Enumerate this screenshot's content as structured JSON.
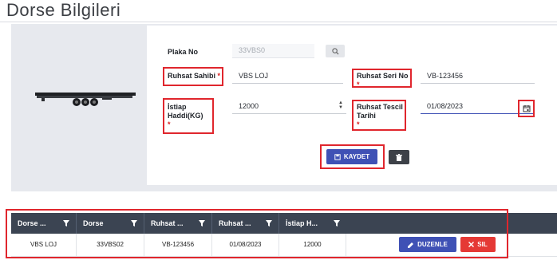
{
  "page": {
    "title": "Dorse Bilgileri"
  },
  "form": {
    "plaka": {
      "label": "Plaka No",
      "value": "33VBS0"
    },
    "ruhsat_sahibi": {
      "label": "Ruhsat Sahibi",
      "required_mark": "*",
      "value": "VBS LOJ"
    },
    "ruhsat_seri": {
      "label": "Ruhsat Seri No",
      "required_mark": "*",
      "value": "VB-123456"
    },
    "istiap": {
      "label_line1": "İstiap",
      "label_line2": "Haddi(KG)",
      "required_mark": "*",
      "value": "12000"
    },
    "tescil": {
      "label_line1": "Ruhsat Tescil",
      "label_line2": "Tarihi",
      "required_mark": "*",
      "value": "01/08/2023"
    },
    "save_label": "KAYDET"
  },
  "grid": {
    "columns": [
      "Dorse ...",
      "Dorse",
      "Ruhsat ...",
      "Ruhsat ...",
      "İstiap H..."
    ],
    "rows": [
      {
        "cells": [
          "VBS LOJ",
          "33VBS02",
          "VB-123456",
          "01/08/2023",
          "12000"
        ]
      }
    ],
    "edit_label": "DUZENLE",
    "delete_label": "SIL"
  },
  "colors": {
    "primary": "#3f51b5",
    "danger": "#e53935",
    "header": "#3b4452",
    "highlight": "#e0262d"
  }
}
